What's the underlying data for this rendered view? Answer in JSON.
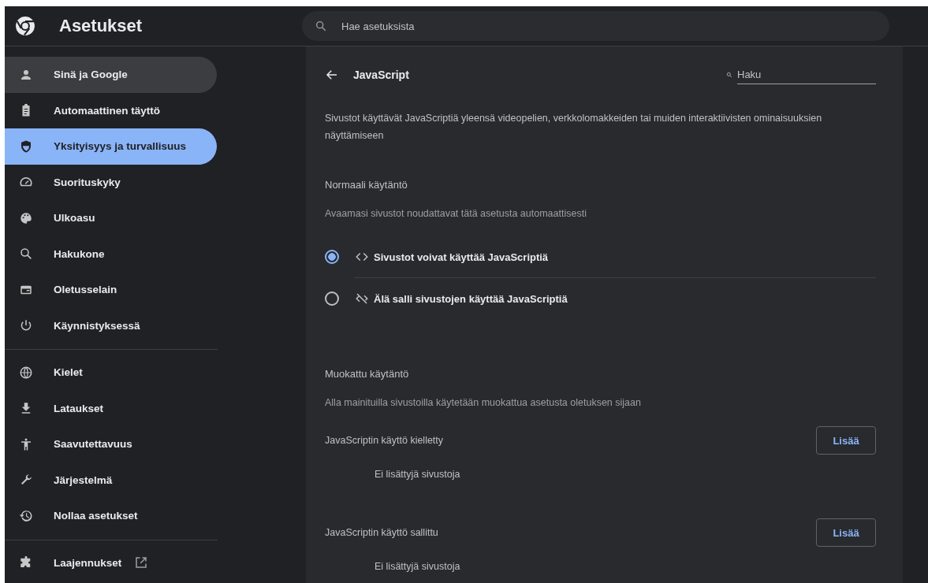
{
  "header": {
    "title": "Asetukset",
    "search_placeholder": "Hae asetuksista"
  },
  "sidebar": {
    "groups": [
      {
        "items": [
          {
            "label": "Sinä ja Google",
            "selected": false,
            "hovered": true
          },
          {
            "label": "Automaattinen täyttö",
            "selected": false,
            "hovered": false
          },
          {
            "label": "Yksityisyys ja turvallisuus",
            "selected": true,
            "hovered": false
          },
          {
            "label": "Suorituskyky",
            "selected": false,
            "hovered": false
          },
          {
            "label": "Ulkoasu",
            "selected": false,
            "hovered": false
          },
          {
            "label": "Hakukone",
            "selected": false,
            "hovered": false
          },
          {
            "label": "Oletusselain",
            "selected": false,
            "hovered": false
          },
          {
            "label": "Käynnistyksessä",
            "selected": false,
            "hovered": false
          }
        ]
      },
      {
        "items": [
          {
            "label": "Kielet",
            "selected": false,
            "hovered": false
          },
          {
            "label": "Lataukset",
            "selected": false,
            "hovered": false
          },
          {
            "label": "Saavutettavuus",
            "selected": false,
            "hovered": false
          },
          {
            "label": "Järjestelmä",
            "selected": false,
            "hovered": false
          },
          {
            "label": "Nollaa asetukset",
            "selected": false,
            "hovered": false
          }
        ]
      },
      {
        "items": [
          {
            "label": "Laajennukset",
            "selected": false,
            "hovered": false,
            "external": true
          }
        ]
      }
    ]
  },
  "page": {
    "title": "JavaScript",
    "search_placeholder": "Haku",
    "description": "Sivustot käyttävät JavaScriptiä yleensä videopelien, verkkolomakkeiden tai muiden interaktiivisten ominaisuuksien näyttämiseen",
    "default_behavior": {
      "heading": "Normaali käytäntö",
      "subtitle": "Avaamasi sivustot noudattavat tätä asetusta automaattisesti",
      "options": [
        {
          "label": "Sivustot voivat käyttää JavaScriptiä",
          "selected": true
        },
        {
          "label": "Älä salli sivustojen käyttää JavaScriptiä",
          "selected": false
        }
      ]
    },
    "custom_behavior": {
      "heading": "Muokattu käytäntö",
      "subtitle": "Alla mainituilla sivustoilla käytetään muokattua asetusta oletuksen sijaan",
      "lists": [
        {
          "title": "JavaScriptin käyttö kielletty",
          "button": "Lisää",
          "empty": "Ei lisättyjä sivustoja"
        },
        {
          "title": "JavaScriptin käyttö sallittu",
          "button": "Lisää",
          "empty": "Ei lisättyjä sivustoja"
        }
      ]
    }
  }
}
